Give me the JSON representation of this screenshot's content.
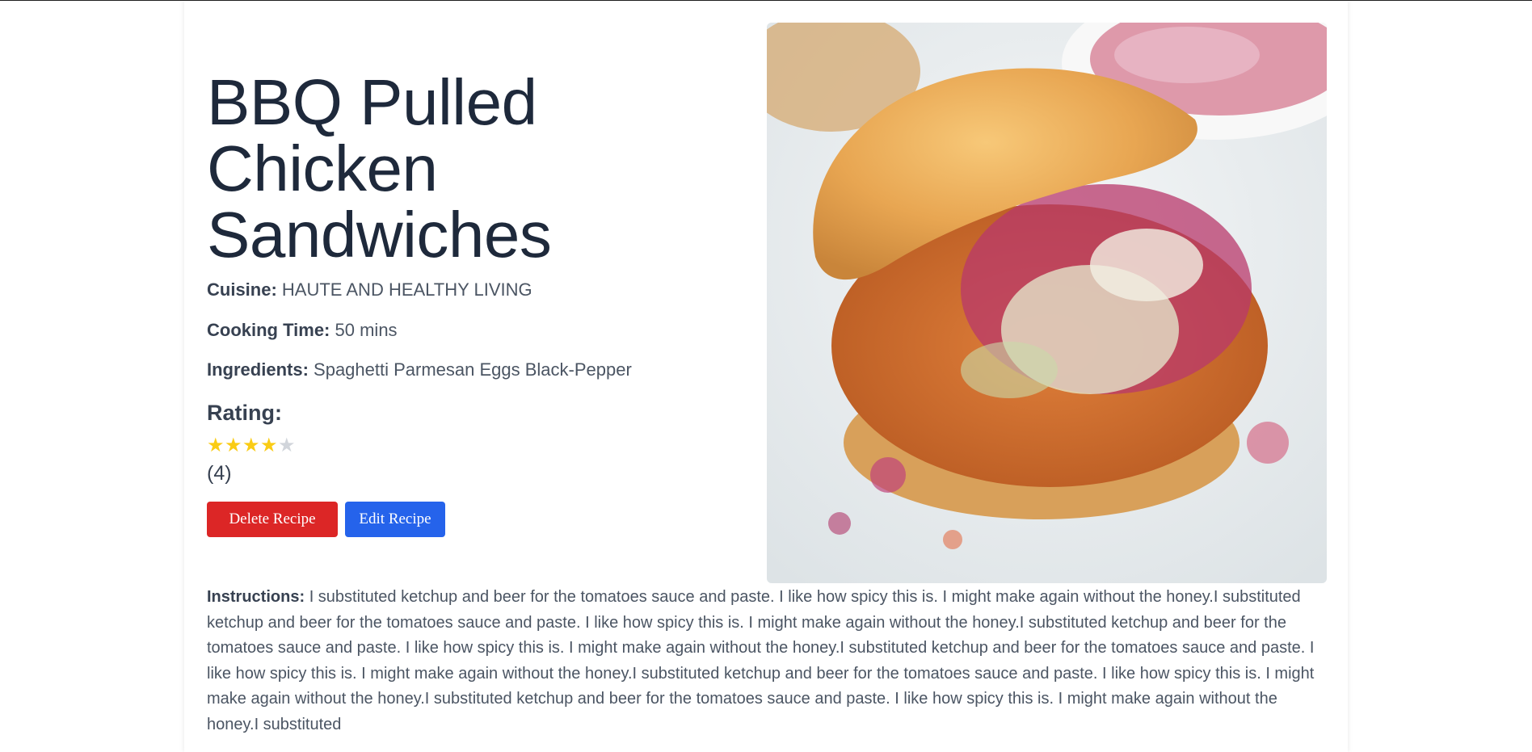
{
  "recipe": {
    "title_lines": [
      "BBQ Pulled",
      "Chicken",
      "Sandwiches"
    ],
    "cuisine_label": "Cuisine:",
    "cuisine_value": "HAUTE AND HEALTHY LIVING",
    "cooking_time_label": "Cooking Time:",
    "cooking_time_value": "50 mins",
    "ingredients_label": "Ingredients:",
    "ingredients_value": "Spaghetti Parmesan Eggs Black-Pepper",
    "rating_label": "Rating:",
    "rating_value": 4,
    "rating_max": 5,
    "rating_count": "(4)",
    "instructions_label": "Instructions:",
    "instructions_text": "I substituted ketchup and beer for the tomatoes sauce and paste. I like how spicy this is. I might make again without the honey.I substituted ketchup and beer for the tomatoes sauce and paste. I like how spicy this is. I might make again without the honey.I substituted ketchup and beer for the tomatoes sauce and paste. I like how spicy this is. I might make again without the honey.I substituted ketchup and beer for the tomatoes sauce and paste. I like how spicy this is. I might make again without the honey.I substituted ketchup and beer for the tomatoes sauce and paste. I like how spicy this is. I might make again without the honey.I substituted ketchup and beer for the tomatoes sauce and paste. I like how spicy this is. I might make again without the honey.I substituted"
  },
  "actions": {
    "delete_label": "Delete Recipe",
    "edit_label": "Edit Recipe"
  },
  "colors": {
    "star_filled": "#facc15",
    "star_empty": "#d1d5db",
    "delete": "#dc2626",
    "edit": "#2563eb",
    "heading": "#1e293b"
  },
  "photo": {
    "icon": "sandwich-photo"
  }
}
